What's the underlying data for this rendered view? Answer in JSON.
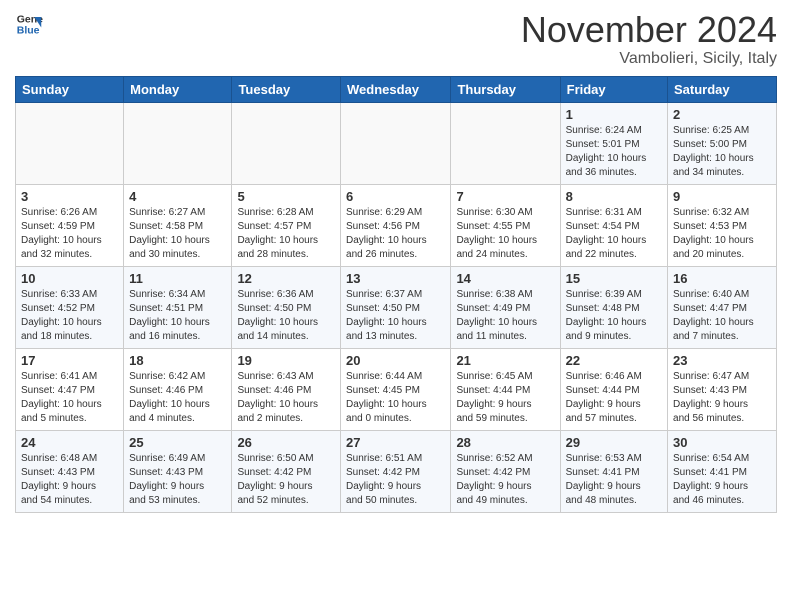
{
  "logo": {
    "line1": "General",
    "line2": "Blue"
  },
  "title": "November 2024",
  "location": "Vambolieri, Sicily, Italy",
  "weekdays": [
    "Sunday",
    "Monday",
    "Tuesday",
    "Wednesday",
    "Thursday",
    "Friday",
    "Saturday"
  ],
  "weeks": [
    [
      {
        "day": "",
        "info": ""
      },
      {
        "day": "",
        "info": ""
      },
      {
        "day": "",
        "info": ""
      },
      {
        "day": "",
        "info": ""
      },
      {
        "day": "",
        "info": ""
      },
      {
        "day": "1",
        "info": "Sunrise: 6:24 AM\nSunset: 5:01 PM\nDaylight: 10 hours\nand 36 minutes."
      },
      {
        "day": "2",
        "info": "Sunrise: 6:25 AM\nSunset: 5:00 PM\nDaylight: 10 hours\nand 34 minutes."
      }
    ],
    [
      {
        "day": "3",
        "info": "Sunrise: 6:26 AM\nSunset: 4:59 PM\nDaylight: 10 hours\nand 32 minutes."
      },
      {
        "day": "4",
        "info": "Sunrise: 6:27 AM\nSunset: 4:58 PM\nDaylight: 10 hours\nand 30 minutes."
      },
      {
        "day": "5",
        "info": "Sunrise: 6:28 AM\nSunset: 4:57 PM\nDaylight: 10 hours\nand 28 minutes."
      },
      {
        "day": "6",
        "info": "Sunrise: 6:29 AM\nSunset: 4:56 PM\nDaylight: 10 hours\nand 26 minutes."
      },
      {
        "day": "7",
        "info": "Sunrise: 6:30 AM\nSunset: 4:55 PM\nDaylight: 10 hours\nand 24 minutes."
      },
      {
        "day": "8",
        "info": "Sunrise: 6:31 AM\nSunset: 4:54 PM\nDaylight: 10 hours\nand 22 minutes."
      },
      {
        "day": "9",
        "info": "Sunrise: 6:32 AM\nSunset: 4:53 PM\nDaylight: 10 hours\nand 20 minutes."
      }
    ],
    [
      {
        "day": "10",
        "info": "Sunrise: 6:33 AM\nSunset: 4:52 PM\nDaylight: 10 hours\nand 18 minutes."
      },
      {
        "day": "11",
        "info": "Sunrise: 6:34 AM\nSunset: 4:51 PM\nDaylight: 10 hours\nand 16 minutes."
      },
      {
        "day": "12",
        "info": "Sunrise: 6:36 AM\nSunset: 4:50 PM\nDaylight: 10 hours\nand 14 minutes."
      },
      {
        "day": "13",
        "info": "Sunrise: 6:37 AM\nSunset: 4:50 PM\nDaylight: 10 hours\nand 13 minutes."
      },
      {
        "day": "14",
        "info": "Sunrise: 6:38 AM\nSunset: 4:49 PM\nDaylight: 10 hours\nand 11 minutes."
      },
      {
        "day": "15",
        "info": "Sunrise: 6:39 AM\nSunset: 4:48 PM\nDaylight: 10 hours\nand 9 minutes."
      },
      {
        "day": "16",
        "info": "Sunrise: 6:40 AM\nSunset: 4:47 PM\nDaylight: 10 hours\nand 7 minutes."
      }
    ],
    [
      {
        "day": "17",
        "info": "Sunrise: 6:41 AM\nSunset: 4:47 PM\nDaylight: 10 hours\nand 5 minutes."
      },
      {
        "day": "18",
        "info": "Sunrise: 6:42 AM\nSunset: 4:46 PM\nDaylight: 10 hours\nand 4 minutes."
      },
      {
        "day": "19",
        "info": "Sunrise: 6:43 AM\nSunset: 4:46 PM\nDaylight: 10 hours\nand 2 minutes."
      },
      {
        "day": "20",
        "info": "Sunrise: 6:44 AM\nSunset: 4:45 PM\nDaylight: 10 hours\nand 0 minutes."
      },
      {
        "day": "21",
        "info": "Sunrise: 6:45 AM\nSunset: 4:44 PM\nDaylight: 9 hours\nand 59 minutes."
      },
      {
        "day": "22",
        "info": "Sunrise: 6:46 AM\nSunset: 4:44 PM\nDaylight: 9 hours\nand 57 minutes."
      },
      {
        "day": "23",
        "info": "Sunrise: 6:47 AM\nSunset: 4:43 PM\nDaylight: 9 hours\nand 56 minutes."
      }
    ],
    [
      {
        "day": "24",
        "info": "Sunrise: 6:48 AM\nSunset: 4:43 PM\nDaylight: 9 hours\nand 54 minutes."
      },
      {
        "day": "25",
        "info": "Sunrise: 6:49 AM\nSunset: 4:43 PM\nDaylight: 9 hours\nand 53 minutes."
      },
      {
        "day": "26",
        "info": "Sunrise: 6:50 AM\nSunset: 4:42 PM\nDaylight: 9 hours\nand 52 minutes."
      },
      {
        "day": "27",
        "info": "Sunrise: 6:51 AM\nSunset: 4:42 PM\nDaylight: 9 hours\nand 50 minutes."
      },
      {
        "day": "28",
        "info": "Sunrise: 6:52 AM\nSunset: 4:42 PM\nDaylight: 9 hours\nand 49 minutes."
      },
      {
        "day": "29",
        "info": "Sunrise: 6:53 AM\nSunset: 4:41 PM\nDaylight: 9 hours\nand 48 minutes."
      },
      {
        "day": "30",
        "info": "Sunrise: 6:54 AM\nSunset: 4:41 PM\nDaylight: 9 hours\nand 46 minutes."
      }
    ]
  ]
}
